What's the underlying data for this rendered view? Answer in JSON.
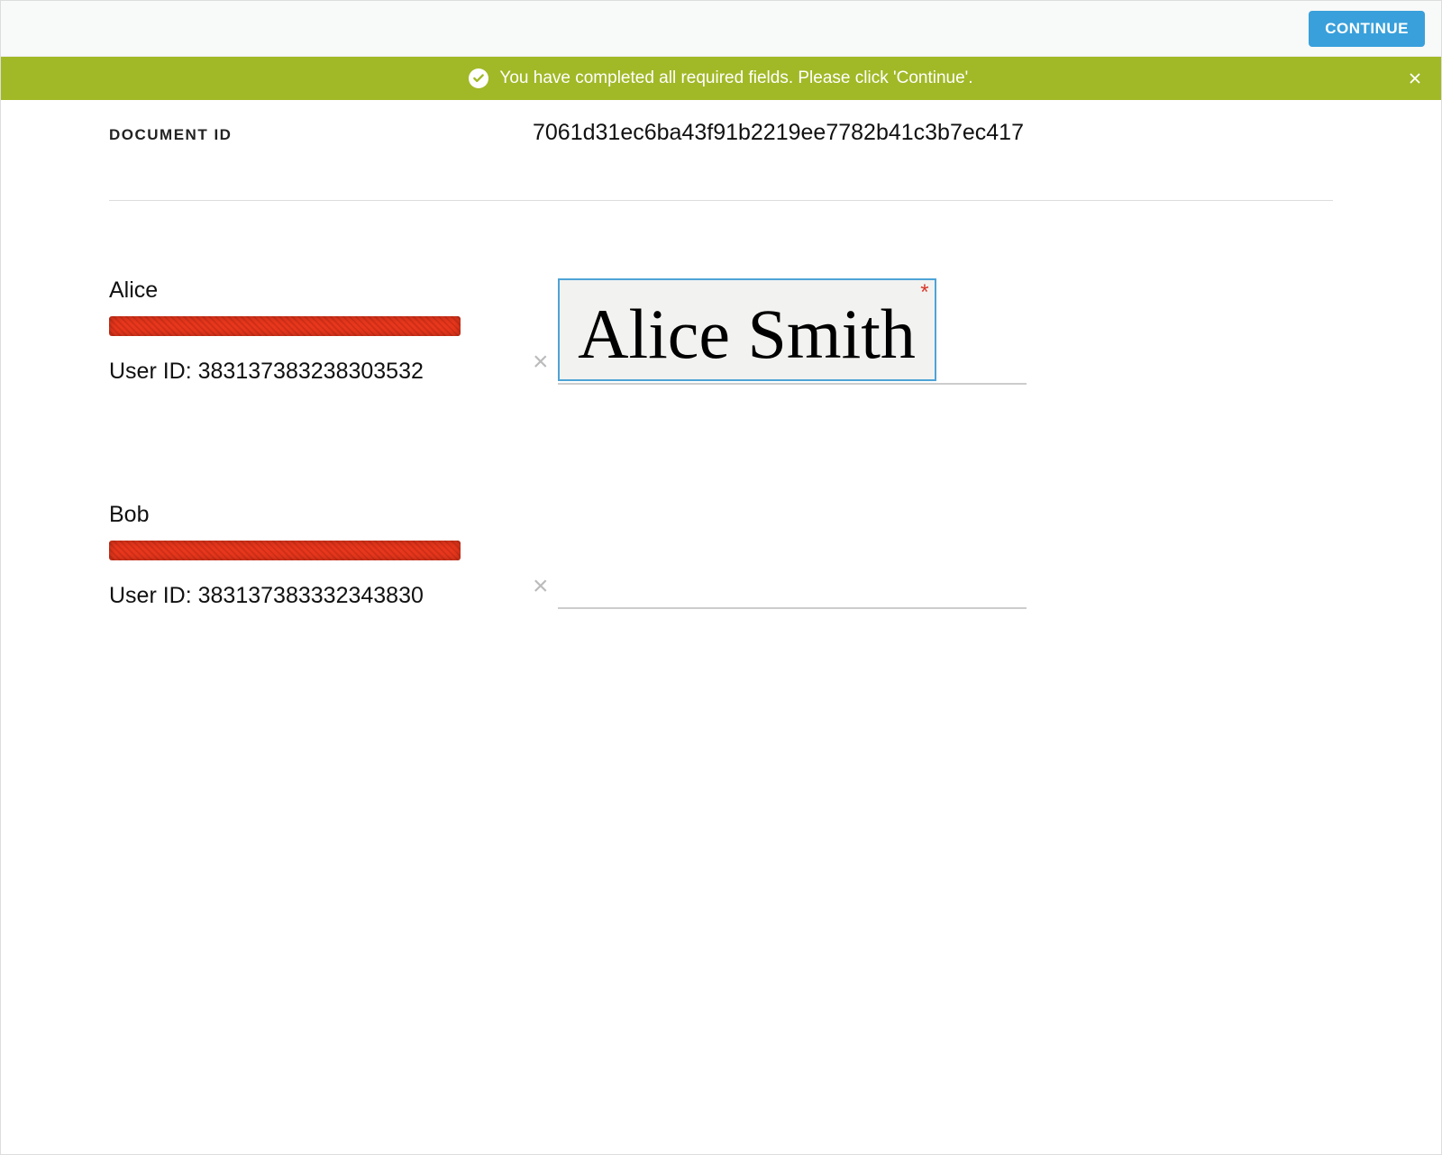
{
  "header": {
    "continue_label": "CONTINUE"
  },
  "banner": {
    "message": "You have completed all required fields. Please click 'Continue'."
  },
  "document": {
    "label": "DOCUMENT ID",
    "value": "7061d31ec6ba43f91b2219ee7782b41c3b7ec417"
  },
  "signers": [
    {
      "name": "Alice",
      "user_id_label": "User ID: 383137383238303532",
      "signature_text": "Alice Smith",
      "signed": true
    },
    {
      "name": "Bob",
      "user_id_label": "User ID: 383137383332343830",
      "signature_text": "",
      "signed": false
    }
  ],
  "x_mark": "×",
  "required_mark": "*"
}
